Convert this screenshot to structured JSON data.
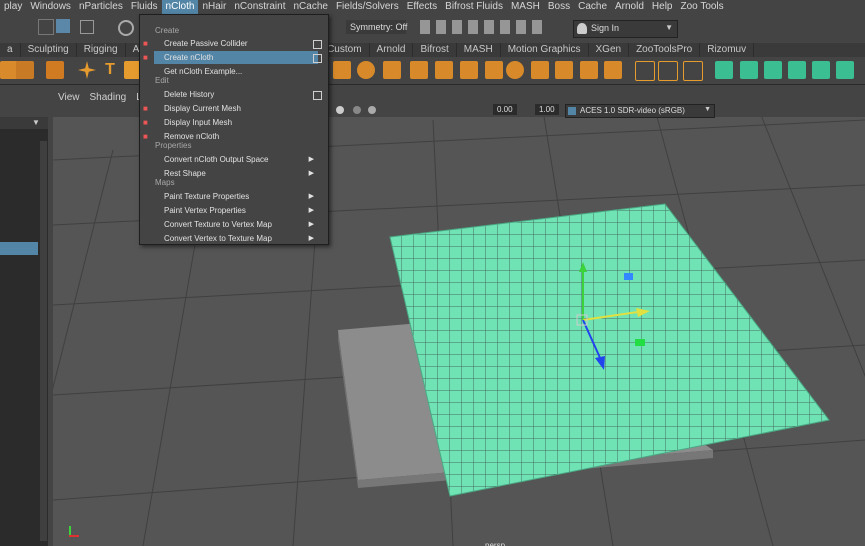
{
  "menubar": {
    "items": [
      "play",
      "Windows",
      "nParticles",
      "Fluids",
      "nCloth",
      "nHair",
      "nConstraint",
      "nCache",
      "Fields/Solvers",
      "Effects",
      "Bifrost Fluids",
      "MASH",
      "Boss",
      "Cache",
      "Arnold",
      "Help",
      "Zoo Tools"
    ],
    "active_index": 4
  },
  "statusline": {
    "symmetry_label": "Symmetry: Off",
    "sign_in_label": "Sign In"
  },
  "shelf_tabs": [
    "a",
    "Sculpting",
    "Rigging",
    "Ani",
    "",
    "Custom",
    "Arnold",
    "Bifrost",
    "MASH",
    "Motion Graphics",
    "XGen",
    "ZooToolsPro",
    "Rizomuv"
  ],
  "panel_menu": [
    "View",
    "Shading",
    "Ligh"
  ],
  "panel_toolbar": {
    "value1": "0.00",
    "value2": "1.00",
    "colorspace": "ACES 1.0 SDR-video (sRGB)"
  },
  "ncloth_menu": {
    "sections": {
      "create": "Create",
      "edit": "Edit",
      "properties": "Properties",
      "maps": "Maps"
    },
    "items": [
      {
        "label": "Create Passive Collider",
        "has_box": true,
        "has_arrow": false,
        "highlight": false,
        "icon": "tshirt-icon"
      },
      {
        "label": "Create nCloth",
        "has_box": true,
        "has_arrow": false,
        "highlight": true,
        "icon": "tshirt-icon"
      },
      {
        "label": "Get nCloth Example...",
        "has_box": false,
        "has_arrow": false,
        "highlight": false,
        "icon": ""
      },
      {
        "label": "Delete History",
        "has_box": true,
        "has_arrow": false,
        "highlight": false,
        "icon": ""
      },
      {
        "label": "Display Current Mesh",
        "has_box": false,
        "has_arrow": false,
        "highlight": false,
        "icon": "tshirt-icon"
      },
      {
        "label": "Display Input Mesh",
        "has_box": false,
        "has_arrow": false,
        "highlight": false,
        "icon": "tshirt-icon"
      },
      {
        "label": "Remove nCloth",
        "has_box": false,
        "has_arrow": false,
        "highlight": false,
        "icon": "tshirt-icon"
      },
      {
        "label": "Convert nCloth Output Space",
        "has_box": false,
        "has_arrow": true,
        "highlight": false,
        "icon": ""
      },
      {
        "label": "Rest Shape",
        "has_box": false,
        "has_arrow": true,
        "highlight": false,
        "icon": ""
      },
      {
        "label": "Paint Texture Properties",
        "has_box": false,
        "has_arrow": true,
        "highlight": false,
        "icon": ""
      },
      {
        "label": "Paint Vertex Properties",
        "has_box": false,
        "has_arrow": true,
        "highlight": false,
        "icon": ""
      },
      {
        "label": "Convert Texture to Vertex Map",
        "has_box": false,
        "has_arrow": true,
        "highlight": false,
        "icon": ""
      },
      {
        "label": "Convert Vertex to Texture Map",
        "has_box": false,
        "has_arrow": true,
        "highlight": false,
        "icon": ""
      }
    ]
  },
  "viewport": {
    "camera_label": "persp"
  },
  "colors": {
    "accent": "#5285a6",
    "mesh_green": "#6fe3b4",
    "grid_dark": "#3a3a3a"
  }
}
